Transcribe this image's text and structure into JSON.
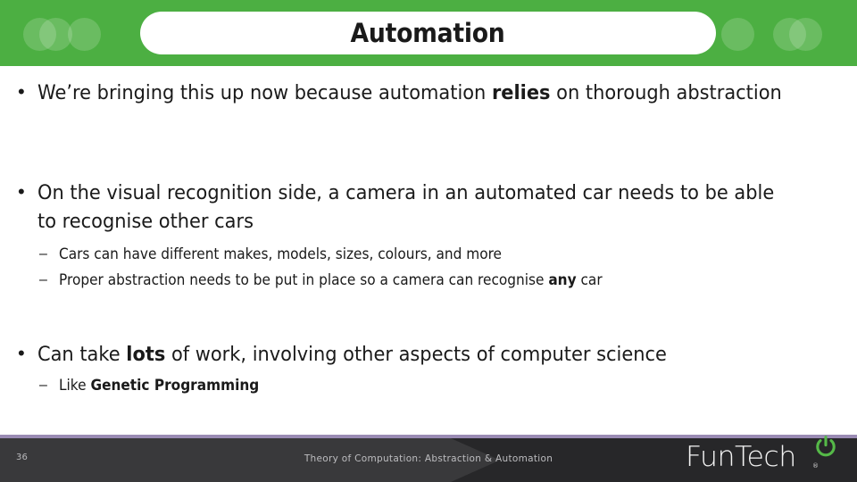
{
  "slide": {
    "title": "Automation",
    "accent_green": "#4caf42",
    "footer_line_color": "#9a8bb4",
    "footer_bg_color": "#272729",
    "logo_power_color": "#55b948"
  },
  "header": {
    "title": "Automation",
    "decorations": [
      "circle-left-a",
      "circle-left-b",
      "circle-left-c",
      "circle-right-a",
      "circle-right-b",
      "circle-right-c"
    ]
  },
  "body": {
    "bullets": [
      {
        "level": 1,
        "marker": "•",
        "parts": [
          {
            "text": "We’re bringing this up now because automation ",
            "bold": false
          },
          {
            "text": "relies",
            "bold": true
          },
          {
            "text": " on thorough abstraction",
            "bold": false
          }
        ],
        "plain": "We’re bringing this up now because automation relies on thorough abstraction"
      },
      {
        "level": 1,
        "marker": "•",
        "parts": [
          {
            "text": "On the visual recognition side, a camera in an automated car needs to be able to recognise other cars",
            "bold": false
          }
        ],
        "plain": "On the visual recognition side, a camera in an automated car needs to be able to recognise other cars"
      },
      {
        "level": 2,
        "marker": "–",
        "parts": [
          {
            "text": "Cars can have different makes, models, sizes, colours, and more",
            "bold": false
          }
        ],
        "plain": "Cars can have different makes, models, sizes, colours, and more"
      },
      {
        "level": 2,
        "marker": "–",
        "parts": [
          {
            "text": "Proper abstraction needs to be put in place so a camera can recognise ",
            "bold": false
          },
          {
            "text": "any",
            "bold": true
          },
          {
            "text": " car",
            "bold": false
          }
        ],
        "plain": "Proper abstraction needs to be put in place so a camera can recognise any car"
      },
      {
        "level": 1,
        "marker": "•",
        "parts": [
          {
            "text": "Can take ",
            "bold": false
          },
          {
            "text": "lots",
            "bold": true
          },
          {
            "text": " of work, involving other aspects of computer science",
            "bold": false
          }
        ],
        "plain": "Can take lots of work, involving other aspects of computer science"
      },
      {
        "level": 2,
        "marker": "–",
        "parts": [
          {
            "text": "Like ",
            "bold": false
          },
          {
            "text": "Genetic Programming",
            "bold": true
          }
        ],
        "plain": "Like Genetic Programming"
      }
    ]
  },
  "footer": {
    "page_number": "36",
    "subtitle": "Theory of Computation: Abstraction & Automation",
    "logo": {
      "wordmark": "FunTech",
      "registered_mark": "®",
      "icon": "power-icon"
    }
  }
}
